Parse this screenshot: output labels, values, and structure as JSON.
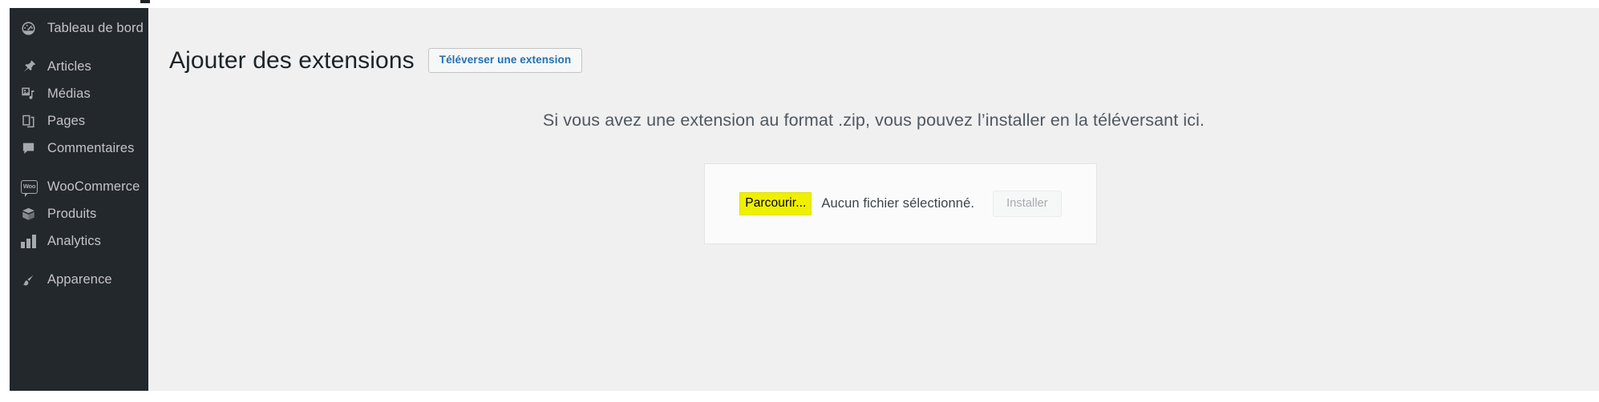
{
  "sidebar": {
    "items": [
      {
        "label": "Tableau de bord",
        "icon": "dashboard-icon",
        "gap_after": "large"
      },
      {
        "label": "Articles",
        "icon": "pin-icon",
        "gap_after": "none"
      },
      {
        "label": "Médias",
        "icon": "media-icon",
        "gap_after": "none"
      },
      {
        "label": "Pages",
        "icon": "pages-icon",
        "gap_after": "none"
      },
      {
        "label": "Commentaires",
        "icon": "comment-icon",
        "gap_after": "large"
      },
      {
        "label": "WooCommerce",
        "icon": "woocommerce-icon",
        "gap_after": "none"
      },
      {
        "label": "Produits",
        "icon": "product-box-icon",
        "gap_after": "none"
      },
      {
        "label": "Analytics",
        "icon": "bar-chart-icon",
        "gap_after": "large"
      },
      {
        "label": "Apparence",
        "icon": "appearance-brush-icon",
        "gap_after": "none"
      }
    ]
  },
  "main": {
    "page_title": "Ajouter des extensions",
    "upload_plugin_button": "Téléverser une extension",
    "upload_hint": "Si vous avez une extension au format .zip, vous pouvez l’installer en la téléversant ici.",
    "browse_button": "Parcourir...",
    "file_status": "Aucun fichier sélectionné.",
    "install_button": "Installer"
  },
  "colors": {
    "sidebar_bg": "#23282d",
    "content_bg": "#f0f0f1",
    "link_blue": "#2271b1",
    "highlight_yellow": "#efef00",
    "title_text": "#1d2327",
    "muted_text": "#50575e",
    "disabled_text": "#a7aaad"
  }
}
